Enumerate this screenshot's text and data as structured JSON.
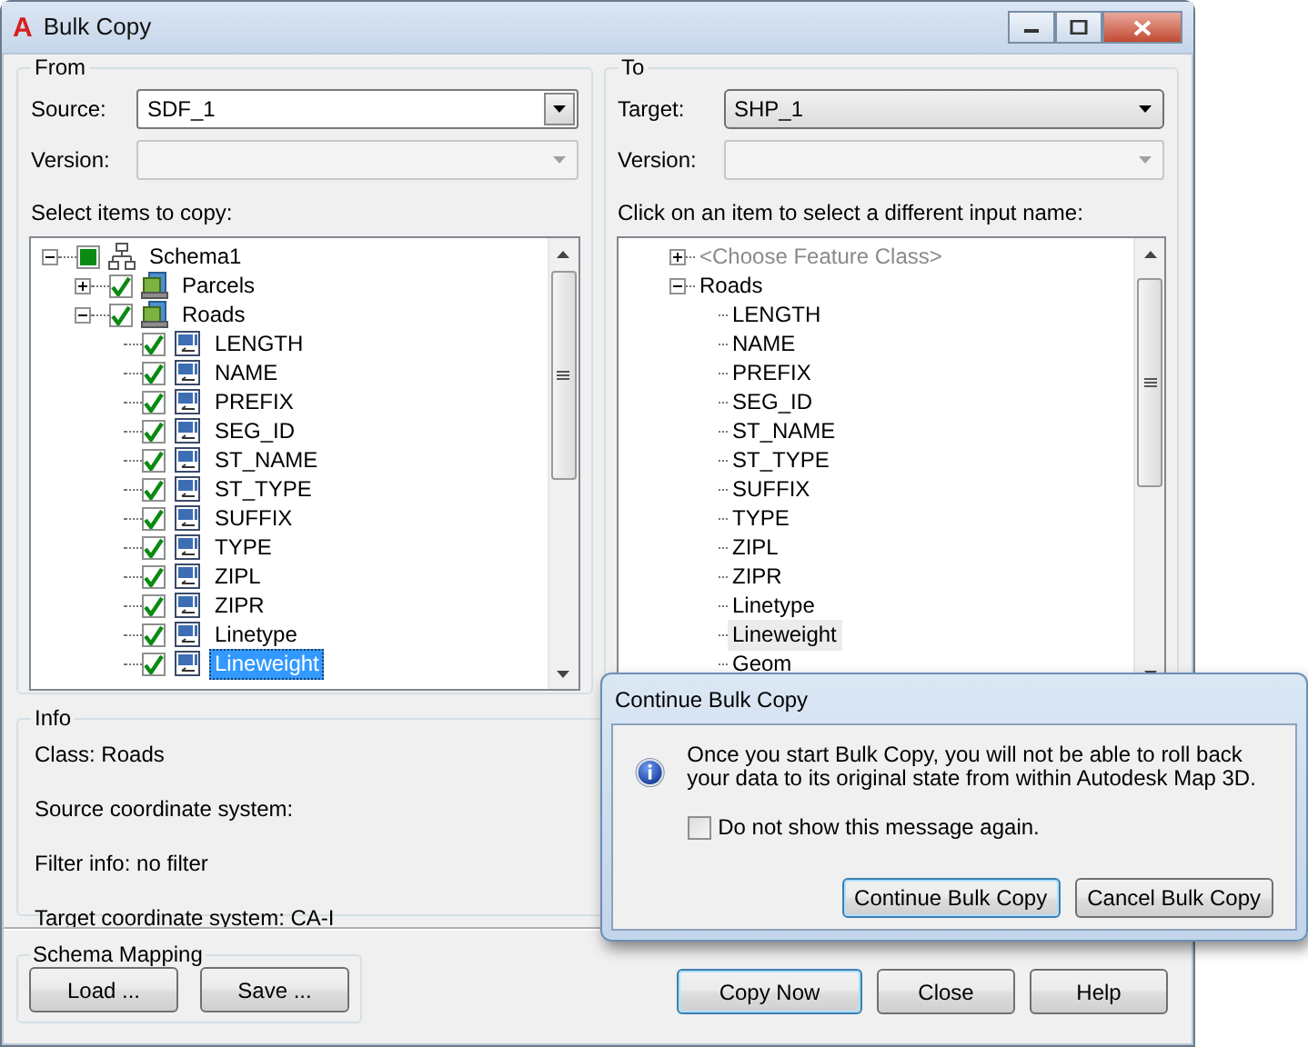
{
  "window": {
    "logo": "A",
    "title": "Bulk Copy"
  },
  "from": {
    "legend": "From",
    "source_label": "Source:",
    "source_value": "SDF_1",
    "version_label": "Version:",
    "tree_label": "Select items to copy:",
    "tree": [
      {
        "label": "Schema1",
        "kind": "schema",
        "expanded": true,
        "checked": true,
        "partial": true,
        "selected": false,
        "children": [
          {
            "label": "Parcels",
            "kind": "class",
            "expanded": false,
            "checked": true,
            "selected": false
          },
          {
            "label": "Roads",
            "kind": "class",
            "expanded": true,
            "checked": true,
            "selected": false,
            "children": [
              {
                "label": "LENGTH",
                "kind": "field",
                "checked": true,
                "selected": false
              },
              {
                "label": "NAME",
                "kind": "field",
                "checked": true,
                "selected": false
              },
              {
                "label": "PREFIX",
                "kind": "field",
                "checked": true,
                "selected": false
              },
              {
                "label": "SEG_ID",
                "kind": "field",
                "checked": true,
                "selected": false
              },
              {
                "label": "ST_NAME",
                "kind": "field",
                "checked": true,
                "selected": false
              },
              {
                "label": "ST_TYPE",
                "kind": "field",
                "checked": true,
                "selected": false
              },
              {
                "label": "SUFFIX",
                "kind": "field",
                "checked": true,
                "selected": false
              },
              {
                "label": "TYPE",
                "kind": "field",
                "checked": true,
                "selected": false
              },
              {
                "label": "ZIPL",
                "kind": "field",
                "checked": true,
                "selected": false
              },
              {
                "label": "ZIPR",
                "kind": "field",
                "checked": true,
                "selected": false
              },
              {
                "label": "Linetype",
                "kind": "field",
                "checked": true,
                "selected": false
              },
              {
                "label": "Lineweight",
                "kind": "field",
                "checked": true,
                "selected": true
              }
            ]
          }
        ]
      }
    ]
  },
  "to": {
    "legend": "To",
    "target_label": "Target:",
    "target_value": "SHP_1",
    "version_label": "Version:",
    "tree_label": "Click on an item to select a different input name:",
    "tree": [
      {
        "label": "<Choose Feature Class>",
        "expanded": false,
        "disabled": true,
        "selected": false
      },
      {
        "label": "Roads",
        "expanded": true,
        "disabled": false,
        "selected": false,
        "children": [
          {
            "label": "LENGTH",
            "disabled": false,
            "selected": false
          },
          {
            "label": "NAME",
            "disabled": false,
            "selected": false
          },
          {
            "label": "PREFIX",
            "disabled": false,
            "selected": false
          },
          {
            "label": "SEG_ID",
            "disabled": false,
            "selected": false
          },
          {
            "label": "ST_NAME",
            "disabled": false,
            "selected": false
          },
          {
            "label": "ST_TYPE",
            "disabled": false,
            "selected": false
          },
          {
            "label": "SUFFIX",
            "disabled": false,
            "selected": false
          },
          {
            "label": "TYPE",
            "disabled": false,
            "selected": false
          },
          {
            "label": "ZIPL",
            "disabled": false,
            "selected": false
          },
          {
            "label": "ZIPR",
            "disabled": false,
            "selected": false
          },
          {
            "label": "Linetype",
            "disabled": false,
            "selected": false
          },
          {
            "label": "Lineweight",
            "disabled": false,
            "selected": true
          },
          {
            "label": "Geom",
            "disabled": false,
            "selected": false
          }
        ]
      }
    ]
  },
  "info": {
    "legend": "Info",
    "lines": [
      "Class: Roads",
      "Source coordinate system:",
      "Filter info: no filter",
      "Target coordinate system: CA-I"
    ]
  },
  "schema_mapping": {
    "legend": "Schema Mapping",
    "buttons": [
      "Load ...",
      "Save ..."
    ]
  },
  "buttons": [
    {
      "label": "Copy Now",
      "default": true
    },
    {
      "label": "Close",
      "default": false
    },
    {
      "label": "Help",
      "default": false
    }
  ],
  "dialog": {
    "title": "Continue Bulk Copy",
    "message": "Once you start Bulk Copy, you will not be able to roll back your data to its original state from within Autodesk Map 3D.",
    "checkbox": {
      "label": "Do not show this message again.",
      "checked": false
    },
    "buttons": [
      {
        "label": "Continue Bulk Copy",
        "default": true
      },
      {
        "label": "Cancel Bulk Copy",
        "default": false
      }
    ]
  }
}
